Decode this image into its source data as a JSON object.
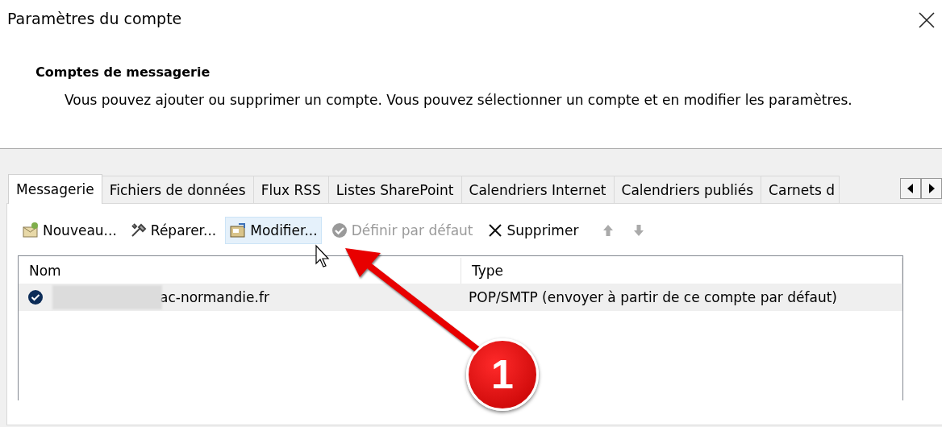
{
  "window": {
    "title": "Paramètres du compte"
  },
  "header": {
    "title": "Comptes de messagerie",
    "description": "Vous pouvez ajouter ou supprimer un compte. Vous pouvez sélectionner un compte et en modifier les paramètres."
  },
  "tabs": [
    {
      "label": "Messagerie",
      "selected": true
    },
    {
      "label": "Fichiers de données",
      "selected": false
    },
    {
      "label": "Flux RSS",
      "selected": false
    },
    {
      "label": "Listes SharePoint",
      "selected": false
    },
    {
      "label": "Calendriers Internet",
      "selected": false
    },
    {
      "label": "Calendriers publiés",
      "selected": false
    },
    {
      "label": "Carnets d",
      "selected": false
    }
  ],
  "toolbar": [
    {
      "kind": "new",
      "label": "Nouveau...",
      "disabled": false,
      "hovered": false
    },
    {
      "kind": "repair",
      "label": "Réparer...",
      "disabled": false,
      "hovered": false
    },
    {
      "kind": "change",
      "label": "Modifier...",
      "disabled": false,
      "hovered": true
    },
    {
      "kind": "default",
      "label": "Définir par défaut",
      "disabled": true,
      "hovered": false
    },
    {
      "kind": "remove",
      "label": "Supprimer",
      "disabled": false,
      "hovered": false
    },
    {
      "kind": "up",
      "disabled": true,
      "hovered": false
    },
    {
      "kind": "down",
      "disabled": true,
      "hovered": false
    }
  ],
  "list": {
    "columns": [
      "Nom",
      "Type"
    ],
    "rows": [
      {
        "name": "ac-normandie.fr",
        "type": "POP/SMTP (envoyer à partir de ce compte par défaut)",
        "selected": true,
        "default": true,
        "redacted": true
      }
    ]
  },
  "annotation": {
    "badge": "1"
  }
}
